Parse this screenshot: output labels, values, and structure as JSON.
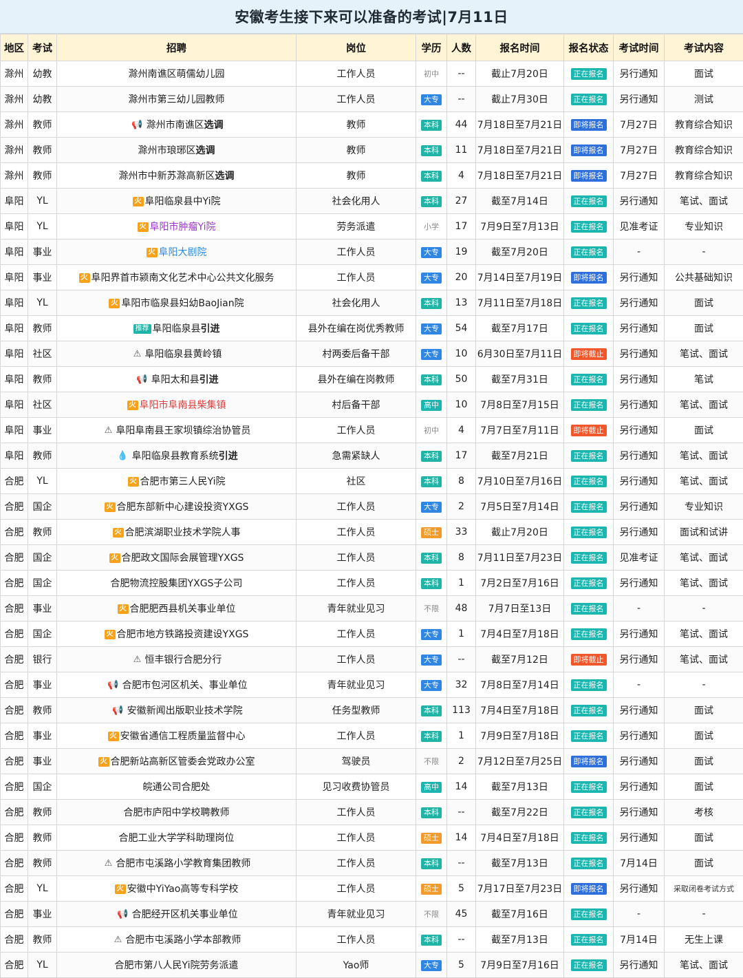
{
  "page_title": "安徽考生接下来可以准备的考试|7月11日",
  "headers": [
    "地区",
    "考试",
    "招聘",
    "岗位",
    "学历",
    "人数",
    "报名时间",
    "报名状态",
    "考试时间",
    "考试内容"
  ],
  "rows": [
    {
      "region": "滁州",
      "type": "幼教",
      "recruit_pre": "",
      "recruit_bold": "",
      "recruit": "滁州南谯区萌儒幼儿园",
      "position": "工作人员",
      "edu": "初中",
      "count": "--",
      "time": "截止7月20日",
      "status": "正在报名",
      "exam_time": "另行通知",
      "content": "面试"
    },
    {
      "region": "滁州",
      "type": "幼教",
      "recruit": "滁州市第三幼儿园教师",
      "position": "工作人员",
      "edu": "大专",
      "count": "--",
      "time": "截止7月30日",
      "status": "正在报名",
      "exam_time": "另行通知",
      "content": "测试"
    },
    {
      "region": "滁州",
      "type": "教师",
      "tag": "horn",
      "recruit": "滁州市南谯区",
      "recruit_bold": "选调",
      "position": "教师",
      "edu": "本科",
      "count": "44",
      "time": "7月18日至7月21日",
      "status": "即将报名",
      "exam_time": "7月27日",
      "content": "教育综合知识"
    },
    {
      "region": "滁州",
      "type": "教师",
      "recruit": "滁州市琅琊区",
      "recruit_bold": "选调",
      "position": "教师",
      "edu": "本科",
      "count": "11",
      "time": "7月18日至7月21日",
      "status": "即将报名",
      "exam_time": "7月27日",
      "content": "教育综合知识"
    },
    {
      "region": "滁州",
      "type": "教师",
      "recruit": "滁州市中新苏滁高新区",
      "recruit_bold": "选调",
      "position": "教师",
      "edu": "本科",
      "count": "4",
      "time": "7月18日至7月21日",
      "status": "即将报名",
      "exam_time": "7月27日",
      "content": "教育综合知识"
    },
    {
      "region": "阜阳",
      "type": "YL",
      "tag": "hot",
      "recruit": "阜阳临泉县中Yi院",
      "position": "社会化用人",
      "edu": "本科",
      "count": "27",
      "time": "截至7月14日",
      "status": "正在报名",
      "exam_time": "另行通知",
      "content": "笔试、面试"
    },
    {
      "region": "阜阳",
      "type": "YL",
      "tag": "hot",
      "recruit": "阜阳市肿瘤Yi院",
      "color": "purple",
      "position": "劳务派遣",
      "edu": "小学",
      "count": "17",
      "time": "7月9日至7月13日",
      "status": "正在报名",
      "exam_time": "见准考证",
      "content": "专业知识"
    },
    {
      "region": "阜阳",
      "type": "事业",
      "tag": "hot",
      "recruit": "阜阳大剧院",
      "color": "blue",
      "position": "工作人员",
      "edu": "大专",
      "count": "19",
      "time": "截至7月20日",
      "status": "正在报名",
      "exam_time": "-",
      "content": "-"
    },
    {
      "region": "阜阳",
      "type": "事业",
      "tag": "hot",
      "recruit": "阜阳界首市颍南文化艺术中心公共文化服务",
      "position": "工作人员",
      "edu": "大专",
      "count": "20",
      "time": "7月14日至7月19日",
      "status": "即将报名",
      "exam_time": "另行通知",
      "content": "公共基础知识"
    },
    {
      "region": "阜阳",
      "type": "YL",
      "tag": "hot",
      "recruit": "阜阳市临泉县妇幼BaoJian院",
      "position": "社会化用人",
      "edu": "本科",
      "count": "13",
      "time": "7月11日至7月18日",
      "status": "正在报名",
      "exam_time": "另行通知",
      "content": "面试"
    },
    {
      "region": "阜阳",
      "type": "教师",
      "tag": "rec",
      "recruit": "阜阳临泉县",
      "recruit_bold": "引进",
      "position": "县外在编在岗优秀教师",
      "edu": "大专",
      "count": "54",
      "time": "截至7月17日",
      "status": "正在报名",
      "exam_time": "另行通知",
      "content": "面试"
    },
    {
      "region": "阜阳",
      "type": "社区",
      "tag": "warn",
      "recruit": "阜阳临泉县黄岭镇",
      "position": "村两委后备干部",
      "edu": "大专",
      "count": "10",
      "time": "6月30日至7月11日",
      "status": "即将截止",
      "exam_time": "另行通知",
      "content": "笔试、面试"
    },
    {
      "region": "阜阳",
      "type": "教师",
      "tag": "horn",
      "recruit": "阜阳太和县",
      "recruit_bold": "引进",
      "position": "县外在编在岗教师",
      "edu": "本科",
      "count": "50",
      "time": "截至7月31日",
      "status": "正在报名",
      "exam_time": "另行通知",
      "content": "笔试"
    },
    {
      "region": "阜阳",
      "type": "社区",
      "tag": "hot",
      "recruit": "阜阳市阜南县柴集镇",
      "color": "red",
      "position": "村后备干部",
      "edu": "高中",
      "count": "10",
      "time": "7月8日至7月15日",
      "status": "正在报名",
      "exam_time": "另行通知",
      "content": "笔试、面试"
    },
    {
      "region": "阜阳",
      "type": "事业",
      "tag": "warn",
      "recruit": "阜阳阜南县王家坝镇综治协管员",
      "position": "工作人员",
      "edu": "初中",
      "count": "4",
      "time": "7月7日至7月11日",
      "status": "即将截止",
      "exam_time": "另行通知",
      "content": "面试"
    },
    {
      "region": "阜阳",
      "type": "教师",
      "tag": "fire",
      "recruit": "阜阳临泉县教育系统",
      "recruit_bold": "引进",
      "position": "急需紧缺人",
      "edu": "本科",
      "count": "17",
      "time": "截至7月21日",
      "status": "正在报名",
      "exam_time": "另行通知",
      "content": "笔试、面试"
    },
    {
      "region": "合肥",
      "type": "YL",
      "tag": "hot",
      "recruit": "合肥市第三人民Yi院",
      "position": "社区",
      "edu": "本科",
      "count": "8",
      "time": "7月10日至7月16日",
      "status": "正在报名",
      "exam_time": "另行通知",
      "content": "笔试、面试"
    },
    {
      "region": "合肥",
      "type": "国企",
      "tag": "hot",
      "recruit": "合肥东部新中心建设投资YXGS",
      "position": "工作人员",
      "edu": "大专",
      "count": "2",
      "time": "7月5日至7月14日",
      "status": "正在报名",
      "exam_time": "另行通知",
      "content": "专业知识"
    },
    {
      "region": "合肥",
      "type": "教师",
      "tag": "hot",
      "recruit": "合肥滨湖职业技术学院人事",
      "position": "工作人员",
      "edu": "硕士",
      "count": "33",
      "time": "截止7月20日",
      "status": "正在报名",
      "exam_time": "另行通知",
      "content": "面试和试讲"
    },
    {
      "region": "合肥",
      "type": "国企",
      "tag": "hot",
      "recruit": "合肥政文国际会展管理YXGS",
      "position": "工作人员",
      "edu": "本科",
      "count": "8",
      "time": "7月11日至7月23日",
      "status": "正在报名",
      "exam_time": "见准考证",
      "content": "笔试、面试"
    },
    {
      "region": "合肥",
      "type": "国企",
      "recruit": "合肥物流控股集团YXGS子公司",
      "position": "工作人员",
      "edu": "本科",
      "count": "1",
      "time": "7月2日至7月16日",
      "status": "正在报名",
      "exam_time": "另行通知",
      "content": "笔试、面试"
    },
    {
      "region": "合肥",
      "type": "事业",
      "tag": "hot",
      "recruit": "合肥肥西县机关事业单位",
      "position": "青年就业见习",
      "edu": "不限",
      "count": "48",
      "time": "7月7日至13日",
      "status": "正在报名",
      "exam_time": "-",
      "content": "-"
    },
    {
      "region": "合肥",
      "type": "国企",
      "tag": "hot",
      "recruit": "合肥市地方铁路投资建设YXGS",
      "position": "工作人员",
      "edu": "大专",
      "count": "1",
      "time": "7月4日至7月18日",
      "status": "正在报名",
      "exam_time": "另行通知",
      "content": "笔试、面试"
    },
    {
      "region": "合肥",
      "type": "银行",
      "tag": "warn",
      "recruit": "恒丰银行合肥分行",
      "position": "工作人员",
      "edu": "大专",
      "count": "--",
      "time": "截至7月12日",
      "status": "即将截止",
      "exam_time": "另行通知",
      "content": "笔试、面试"
    },
    {
      "region": "合肥",
      "type": "事业",
      "tag": "horn",
      "recruit": "合肥市包河区机关、事业单位",
      "position": "青年就业见习",
      "edu": "大专",
      "count": "32",
      "time": "7月8日至7月14日",
      "status": "正在报名",
      "exam_time": "-",
      "content": "-"
    },
    {
      "region": "合肥",
      "type": "教师",
      "tag": "horn",
      "recruit": "安徽新闻出版职业技术学院",
      "position": "任务型教师",
      "edu": "本科",
      "count": "113",
      "time": "7月4日至7月18日",
      "status": "正在报名",
      "exam_time": "另行通知",
      "content": "面试"
    },
    {
      "region": "合肥",
      "type": "事业",
      "tag": "hot",
      "recruit": "安徽省通信工程质量监督中心",
      "position": "工作人员",
      "edu": "本科",
      "count": "1",
      "time": "7月9日至7月18日",
      "status": "正在报名",
      "exam_time": "另行通知",
      "content": "面试"
    },
    {
      "region": "合肥",
      "type": "事业",
      "tag": "hot",
      "recruit": "合肥新站高新区管委会党政办公室",
      "position": "驾驶员",
      "edu": "不限",
      "count": "2",
      "time": "7月12日至7月25日",
      "status": "即将报名",
      "exam_time": "另行通知",
      "content": "面试"
    },
    {
      "region": "合肥",
      "type": "国企",
      "recruit": "皖通公司合肥处",
      "position": "见习收费协管员",
      "edu": "高中",
      "count": "14",
      "time": "截至7月13日",
      "status": "正在报名",
      "exam_time": "另行通知",
      "content": "面试"
    },
    {
      "region": "合肥",
      "type": "教师",
      "recruit": "合肥市庐阳中学校聘教师",
      "position": "工作人员",
      "edu": "本科",
      "count": "--",
      "time": "截至7月22日",
      "status": "正在报名",
      "exam_time": "另行通知",
      "content": "考核"
    },
    {
      "region": "合肥",
      "type": "教师",
      "recruit": "合肥工业大学学科助理岗位",
      "position": "工作人员",
      "edu": "硕士",
      "count": "14",
      "time": "7月4日至7月18日",
      "status": "正在报名",
      "exam_time": "另行通知",
      "content": "面试"
    },
    {
      "region": "合肥",
      "type": "教师",
      "tag": "warn",
      "recruit": "合肥市屯溪路小学教育集团教师",
      "position": "工作人员",
      "edu": "本科",
      "count": "--",
      "time": "截至7月13日",
      "status": "正在报名",
      "exam_time": "7月14日",
      "content": "面试"
    },
    {
      "region": "合肥",
      "type": "YL",
      "tag": "hot",
      "recruit": "安徽中YiYao高等专科学校",
      "position": "工作人员",
      "edu": "硕士",
      "count": "5",
      "time": "7月17日至7月23日",
      "status": "即将报名",
      "exam_time": "另行通知",
      "content": "采取闭卷考试方式",
      "content_small": true
    },
    {
      "region": "合肥",
      "type": "事业",
      "tag": "horn",
      "recruit": "合肥经开区机关事业单位",
      "position": "青年就业见习",
      "edu": "不限",
      "count": "45",
      "time": "截至7月16日",
      "status": "正在报名",
      "exam_time": "-",
      "content": "-"
    },
    {
      "region": "合肥",
      "type": "教师",
      "tag": "warn",
      "recruit": "合肥市屯溪路小学本部教师",
      "position": "工作人员",
      "edu": "本科",
      "count": "--",
      "time": "截至7月13日",
      "status": "正在报名",
      "exam_time": "7月14日",
      "content": "无生上课"
    },
    {
      "region": "合肥",
      "type": "YL",
      "recruit": "合肥市第八人民Yi院劳务派遣",
      "position": "Yao师",
      "edu": "大专",
      "count": "5",
      "time": "7月9日至7月16日",
      "status": "正在报名",
      "exam_time": "另行通知",
      "content": "笔试、面试"
    }
  ],
  "tag_text": {
    "hot": "火",
    "rec": "推荐",
    "horn": "📢",
    "warn": "⚠",
    "fire": "💧"
  }
}
